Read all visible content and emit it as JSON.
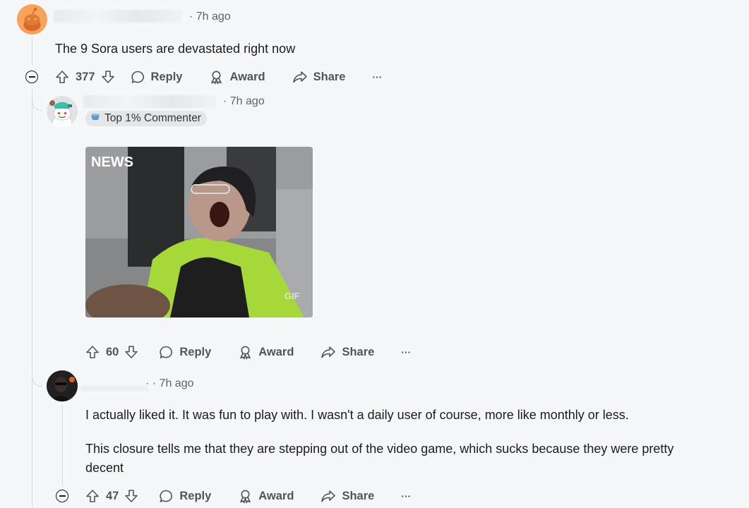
{
  "thread": {
    "comment1": {
      "timestamp": "7h ago",
      "body": "The 9 Sora users are devastated right now",
      "votes": "377",
      "actions": {
        "reply": "Reply",
        "award": "Award",
        "share": "Share",
        "more": "···"
      }
    },
    "comment2": {
      "timestamp": "7h ago",
      "flair": "Top 1% Commenter",
      "media": {
        "watermark": "NEWS",
        "tag": "GIF"
      },
      "votes": "60",
      "actions": {
        "reply": "Reply",
        "award": "Award",
        "share": "Share",
        "more": "···"
      }
    },
    "comment3": {
      "timestamp": "7h ago",
      "paragraphs": [
        "I actually liked it. It was fun to play with. I wasn't a daily user of course, more like monthly or less.",
        "This closure tells me that they are stepping out of the video game, which sucks because they were pretty decent"
      ],
      "votes": "47",
      "actions": {
        "reply": "Reply",
        "award": "Award",
        "share": "Share",
        "more": "···"
      }
    }
  },
  "icons": [
    "upvote-icon",
    "downvote-icon",
    "reply-bubble-icon",
    "award-icon",
    "share-arrow-icon",
    "more-dots-icon",
    "collapse-minus-icon"
  ],
  "colors": {
    "background": "#f6f7f8",
    "thread_line": "#d6d9dc",
    "text": "#1c1c1c",
    "muted": "#5c6368",
    "avatar_orange": "#f7a35a"
  }
}
